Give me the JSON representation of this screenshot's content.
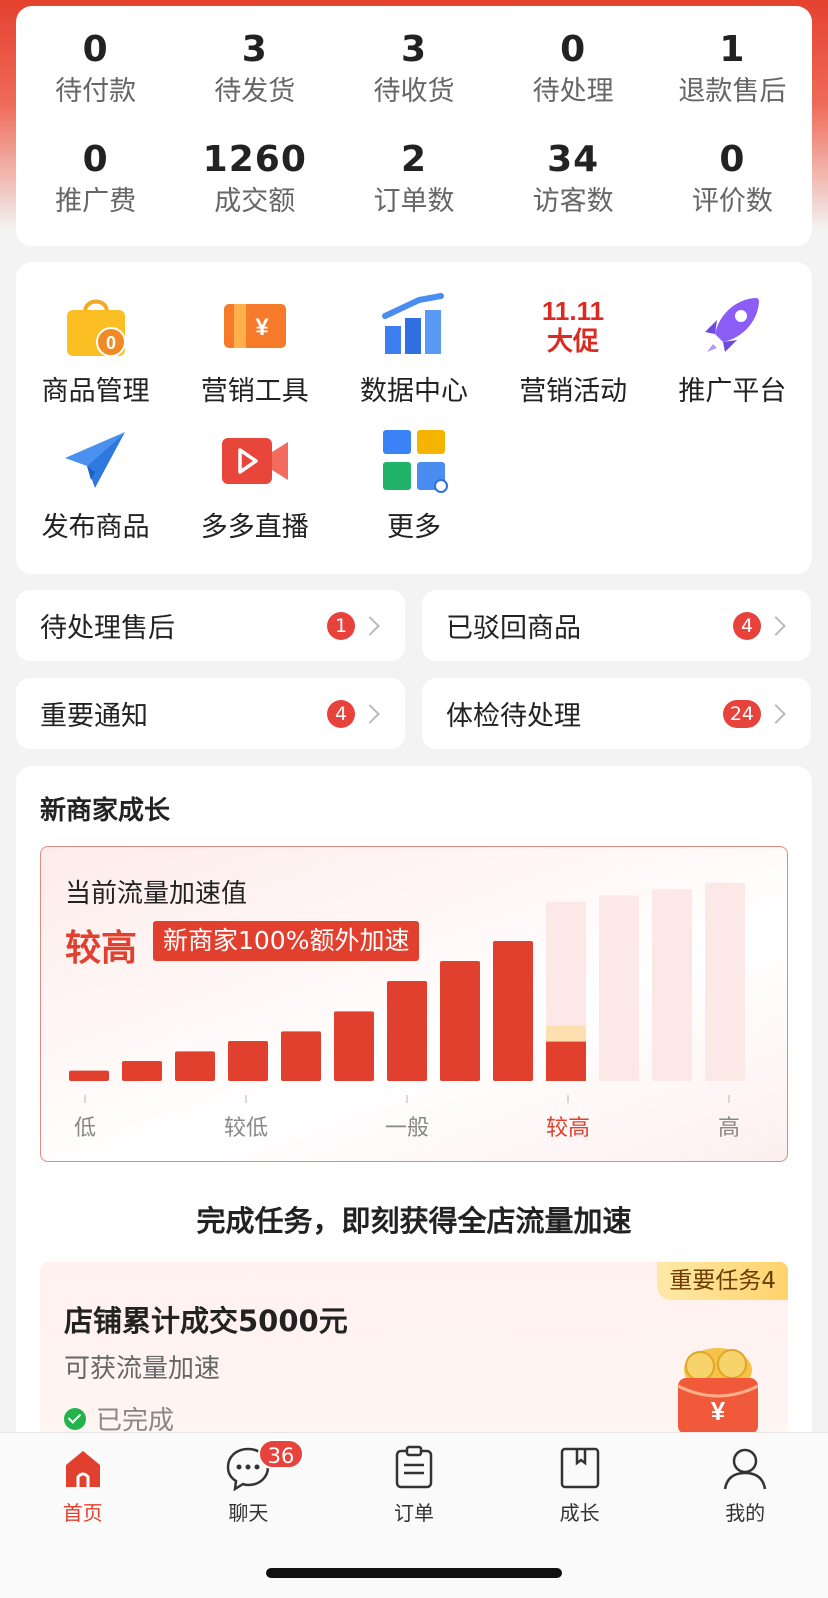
{
  "stats": [
    {
      "value": "0",
      "label": "待付款"
    },
    {
      "value": "3",
      "label": "待发货"
    },
    {
      "value": "3",
      "label": "待收货"
    },
    {
      "value": "0",
      "label": "待处理"
    },
    {
      "value": "1",
      "label": "退款售后"
    },
    {
      "value": "0",
      "label": "推广费"
    },
    {
      "value": "1260",
      "label": "成交额"
    },
    {
      "value": "2",
      "label": "订单数"
    },
    {
      "value": "34",
      "label": "访客数"
    },
    {
      "value": "0",
      "label": "评价数"
    }
  ],
  "tools": [
    {
      "label": "商品管理",
      "icon": "shopping-bag-icon",
      "badge": "0"
    },
    {
      "label": "营销工具",
      "icon": "coupon-icon",
      "badge": "¥"
    },
    {
      "label": "数据中心",
      "icon": "bar-chart-icon"
    },
    {
      "label": "营销活动",
      "icon": "promo-1111-icon",
      "text_top": "11.11",
      "text_bottom": "大促"
    },
    {
      "label": "推广平台",
      "icon": "rocket-icon"
    },
    {
      "label": "发布商品",
      "icon": "paper-plane-icon"
    },
    {
      "label": "多多直播",
      "icon": "video-camera-icon"
    },
    {
      "label": "更多",
      "icon": "more-grid-icon"
    }
  ],
  "shortcuts": [
    {
      "label": "待处理售后",
      "count": "1"
    },
    {
      "label": "已驳回商品",
      "count": "4"
    },
    {
      "label": "重要通知",
      "count": "4"
    },
    {
      "label": "体检待处理",
      "count": "24"
    }
  ],
  "growth": {
    "title": "新商家成长",
    "boost_label": "当前流量加速值",
    "boost_level": "较高",
    "boost_tag": "新商家100%额外加速",
    "task_heading": "完成任务，即刻获得全店流量加速",
    "task": {
      "tag": "重要任务4",
      "title": "店铺累计成交5000元",
      "subtitle": "可获流量加速",
      "status": "已完成"
    }
  },
  "chart_data": {
    "type": "bar",
    "title": "当前流量加速值",
    "tick_labels": [
      "低",
      "较低",
      "一般",
      "较高",
      "高"
    ],
    "active_tick": "较高",
    "bars_filled": [
      0.065,
      0.125,
      0.185,
      0.25,
      0.31,
      0.435,
      0.625,
      0.75,
      0.875,
      1.12
    ],
    "bars_total": 13,
    "current_level_fraction": 0.22,
    "colors": {
      "filled": "#e2402f",
      "empty": "#fce9e7",
      "active_label": "#e2402f"
    }
  },
  "tabbar": [
    {
      "label": "首页",
      "icon": "home-icon",
      "active": true
    },
    {
      "label": "聊天",
      "icon": "chat-icon",
      "badge": "36"
    },
    {
      "label": "订单",
      "icon": "order-icon"
    },
    {
      "label": "成长",
      "icon": "growth-book-icon"
    },
    {
      "label": "我的",
      "icon": "profile-icon"
    }
  ],
  "colors": {
    "brand": "#e2402f",
    "badge": "#e7433c"
  }
}
